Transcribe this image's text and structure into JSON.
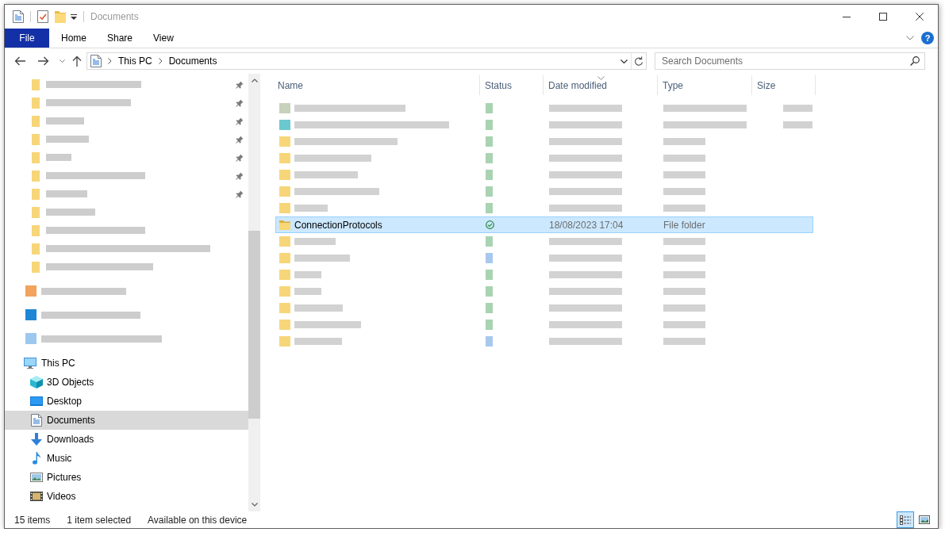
{
  "window": {
    "title": "Documents"
  },
  "ribbon": {
    "file_menu": "File",
    "tabs": [
      {
        "label": "Home",
        "selected": false
      },
      {
        "label": "Share",
        "selected": false
      },
      {
        "label": "View",
        "selected": false
      }
    ],
    "help": "?"
  },
  "address_bar": {
    "path": [
      "This PC",
      "Documents"
    ]
  },
  "search": {
    "placeholder": "Search Documents"
  },
  "nav_pane": {
    "blurred_children": [
      {
        "pinned": true
      },
      {
        "pinned": true
      },
      {
        "pinned": true
      },
      {
        "pinned": true
      },
      {
        "pinned": true
      },
      {
        "pinned": true
      },
      {
        "pinned": true
      },
      {
        "pinned": false
      },
      {
        "pinned": false
      },
      {
        "pinned": false
      },
      {
        "pinned": false
      }
    ],
    "blurred_roots": [
      {
        "color": "#f2a35e"
      },
      {
        "color": "#1f86d6"
      },
      {
        "color": "#9cc8ee"
      }
    ],
    "tree": [
      {
        "label": "This PC",
        "kind": "computer",
        "selected": false,
        "children": [
          {
            "label": "3D Objects",
            "kind": "objects",
            "selected": false
          },
          {
            "label": "Desktop",
            "kind": "desktop",
            "selected": false
          },
          {
            "label": "Documents",
            "kind": "documents",
            "selected": true
          },
          {
            "label": "Downloads",
            "kind": "downloads",
            "selected": false
          },
          {
            "label": "Music",
            "kind": "music",
            "selected": false
          },
          {
            "label": "Pictures",
            "kind": "pictures",
            "selected": false
          },
          {
            "label": "Videos",
            "kind": "videos",
            "selected": false
          }
        ]
      }
    ]
  },
  "file_list": {
    "columns": [
      {
        "label": "Name",
        "sorted": false
      },
      {
        "label": "Status",
        "sorted": false
      },
      {
        "label": "Date modified",
        "sorted": true
      },
      {
        "label": "Type",
        "sorted": false
      },
      {
        "label": "Size",
        "sorted": false
      }
    ],
    "rows": [
      {
        "redacted": true,
        "kind": "file",
        "color": "#c8d1bb",
        "local_copy": true,
        "selected": false
      },
      {
        "redacted": true,
        "kind": "file",
        "color": "#6cc8cf",
        "local_copy": true,
        "selected": false
      },
      {
        "redacted": true,
        "kind": "folder",
        "color": "#f7d679",
        "local_copy": true,
        "selected": false
      },
      {
        "redacted": true,
        "kind": "folder",
        "color": "#f7d679",
        "local_copy": true,
        "selected": false
      },
      {
        "redacted": true,
        "kind": "folder",
        "color": "#f7d679",
        "local_copy": true,
        "selected": false
      },
      {
        "redacted": true,
        "kind": "folder",
        "color": "#f7d679",
        "local_copy": true,
        "selected": false
      },
      {
        "redacted": true,
        "kind": "folder",
        "color": "#f7d679",
        "local_copy": true,
        "selected": false
      },
      {
        "redacted": false,
        "kind": "folder",
        "name": "ConnectionProtocols",
        "local_copy": true,
        "date": "18/08/2023 17:04",
        "type": "File folder",
        "selected": true
      },
      {
        "redacted": true,
        "kind": "folder",
        "color": "#f7d679",
        "local_copy": true,
        "selected": false
      },
      {
        "redacted": true,
        "kind": "folder",
        "color": "#f7d679",
        "local_copy": false,
        "selected": false
      },
      {
        "redacted": true,
        "kind": "folder",
        "color": "#f7d679",
        "local_copy": true,
        "selected": false
      },
      {
        "redacted": true,
        "kind": "folder",
        "color": "#f7d679",
        "local_copy": true,
        "selected": false
      },
      {
        "redacted": true,
        "kind": "folder",
        "color": "#f7d679",
        "local_copy": true,
        "selected": false
      },
      {
        "redacted": true,
        "kind": "folder",
        "color": "#f7d679",
        "local_copy": true,
        "selected": false
      },
      {
        "redacted": true,
        "kind": "folder",
        "color": "#f7d679",
        "local_copy": false,
        "selected": false
      }
    ]
  },
  "status_bar": {
    "item_count": "15 items",
    "selection": "1 item selected",
    "availability": "Available on this device",
    "views": [
      {
        "kind": "details",
        "selected": true
      },
      {
        "kind": "icons",
        "selected": false
      }
    ]
  }
}
